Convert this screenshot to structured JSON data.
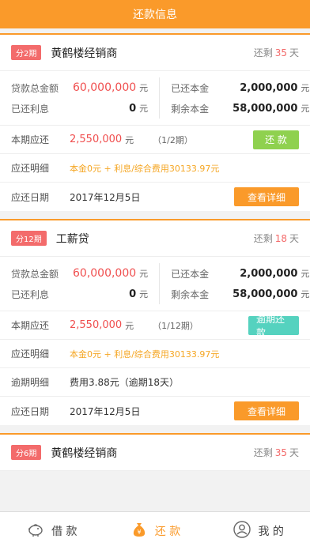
{
  "header": {
    "title": "还款信息"
  },
  "labels": {
    "loan_total": "贷款总金额",
    "repaid_principal": "已还本金",
    "repaid_interest": "已还利息",
    "remaining_principal": "剩余本金",
    "current_due": "本期应还",
    "due_detail": "应还明细",
    "overdue_detail": "逾期明细",
    "due_date": "应还日期",
    "yuan": "元",
    "remain_prefix": "还剩",
    "remain_suffix": "天"
  },
  "cards": [
    {
      "badge": "分2期",
      "merchant": "黄鹤楼经销商",
      "days_left": "35",
      "loan_total": "60,000,000",
      "repaid_principal": "2,000,000",
      "repaid_interest": "0",
      "remaining_principal": "58,000,000",
      "current_due": "2,550,000",
      "period": "（1/2期）",
      "action_label": "还 款",
      "due_detail": "本金0元 + 利息/综合费用30133.97元",
      "due_date": "2017年12月5日",
      "detail_button": "查看详细"
    },
    {
      "badge": "分12期",
      "merchant": "工薪贷",
      "days_left": "18",
      "loan_total": "60,000,000",
      "repaid_principal": "2,000,000",
      "repaid_interest": "0",
      "remaining_principal": "58,000,000",
      "current_due": "2,550,000",
      "period": "（1/12期）",
      "action_label": "逾期还款",
      "due_detail": "本金0元 + 利息/综合费用30133.97元",
      "overdue_detail": "费用3.88元（逾期18天）",
      "due_date": "2017年12月5日",
      "detail_button": "查看详细"
    },
    {
      "badge": "分6期",
      "merchant": "黄鹤楼经销商",
      "days_left": "35"
    }
  ],
  "tabs": [
    {
      "label": "借 款",
      "icon": "piggy-bank-icon"
    },
    {
      "label": "还 款",
      "icon": "money-bag-icon",
      "active": true
    },
    {
      "label": "我 的",
      "icon": "user-icon"
    }
  ],
  "colors": {
    "accent": "#fa9a2a",
    "red": "#f04f4f",
    "green": "#8fd14f",
    "teal": "#55d2bf"
  }
}
